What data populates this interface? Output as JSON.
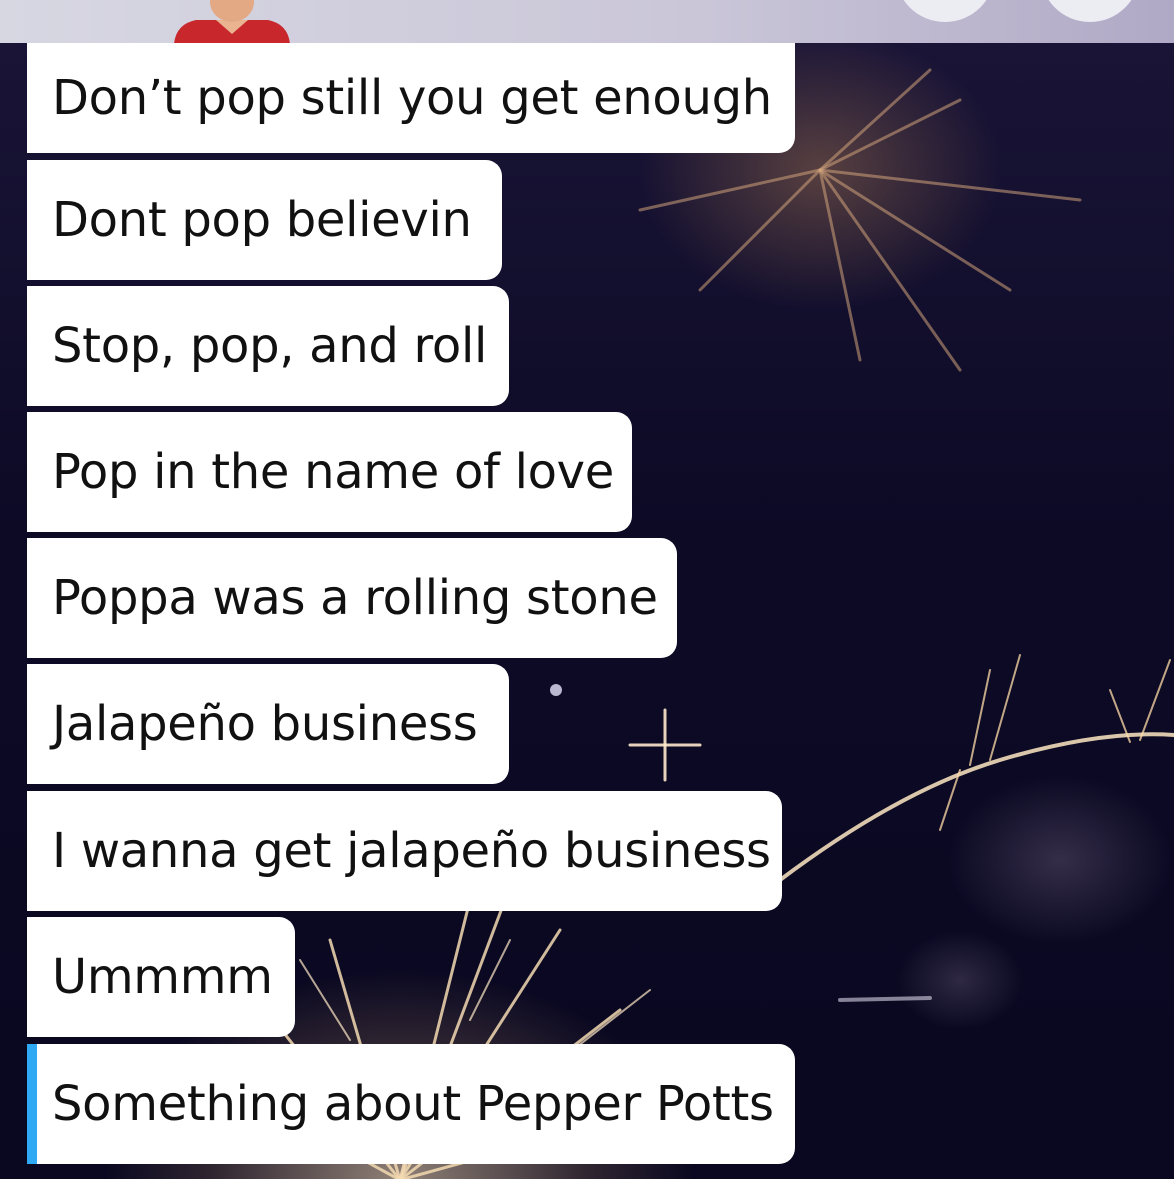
{
  "chat": {
    "messages": [
      {
        "text": "Don’t pop still you get enough"
      },
      {
        "text": "Dont pop believin"
      },
      {
        "text": "Stop, pop, and roll"
      },
      {
        "text": "Pop in the name of love"
      },
      {
        "text": "Poppa was a rolling stone"
      },
      {
        "text": "Jalapeño business"
      },
      {
        "text": "I wanna get jalapeño business"
      },
      {
        "text": "Ummmm"
      },
      {
        "text": "Something about Pepper Potts"
      }
    ],
    "selected_index": 8
  },
  "colors": {
    "bubble_bg": "#ffffff",
    "text": "#111111",
    "selection_accent": "#2fa9f4",
    "topbar_bg": "#d0cddc"
  },
  "icons": {
    "avatar": "bitmoji-avatar-icon"
  }
}
